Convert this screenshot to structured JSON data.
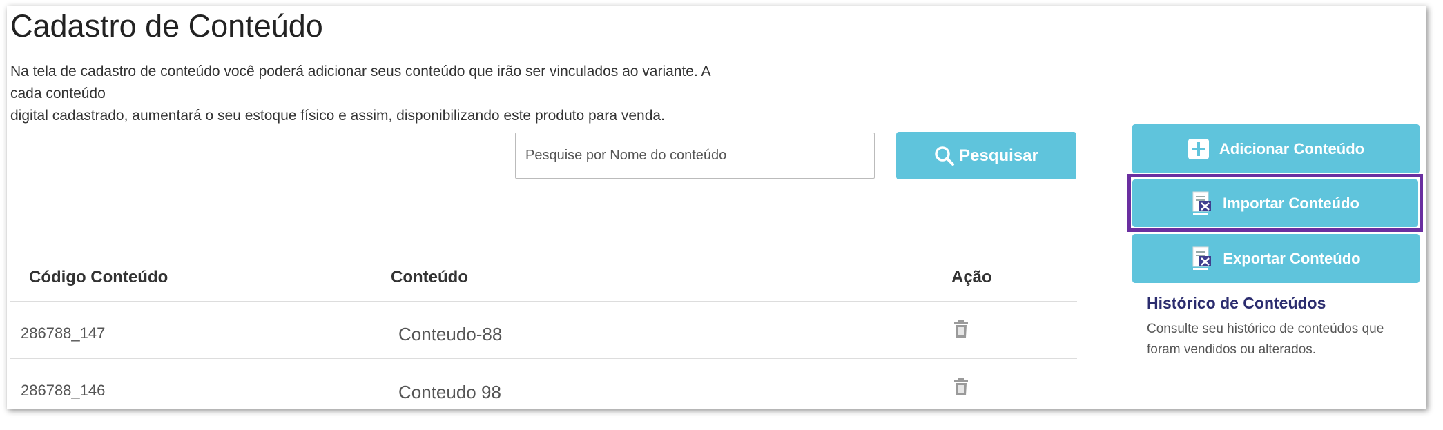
{
  "header": {
    "title": "Cadastro de Conteúdo",
    "description_lines": [
      "Na tela de cadastro de conteúdo você poderá adicionar seus conteúdo que irão ser vinculados ao variante. A",
      "cada conteúdo",
      "digital cadastrado, aumentará o seu estoque físico e assim, disponibilizando este produto para venda."
    ]
  },
  "search": {
    "placeholder": "Pesquise por Nome do conteúdo",
    "value": "",
    "button_label": "Pesquisar",
    "button_icon": "search-icon"
  },
  "actions": {
    "add_label": "Adicionar Conteúdo",
    "add_icon": "plus-square-icon",
    "import_label": "Importar Conteúdo",
    "import_icon": "excel-file-icon",
    "export_label": "Exportar Conteúdo",
    "export_icon": "excel-file-icon",
    "highlight_color": "#6a2fa0"
  },
  "table": {
    "columns": [
      "Código Conteúdo",
      "Conteúdo",
      "Ação"
    ],
    "rows": [
      {
        "code": "286788_147",
        "name": "Conteudo-88",
        "action_icon": "trash-icon"
      },
      {
        "code": "286788_146",
        "name": "Conteudo 98",
        "action_icon": "trash-icon"
      }
    ]
  },
  "history": {
    "title": "Histórico de Conteúdos",
    "description_lines": [
      "Consulte seu histórico de conteúdos que",
      "foram vendidos ou alterados."
    ]
  },
  "colors": {
    "accent": "#5fc4dc",
    "history_title": "#2b2c6e"
  }
}
